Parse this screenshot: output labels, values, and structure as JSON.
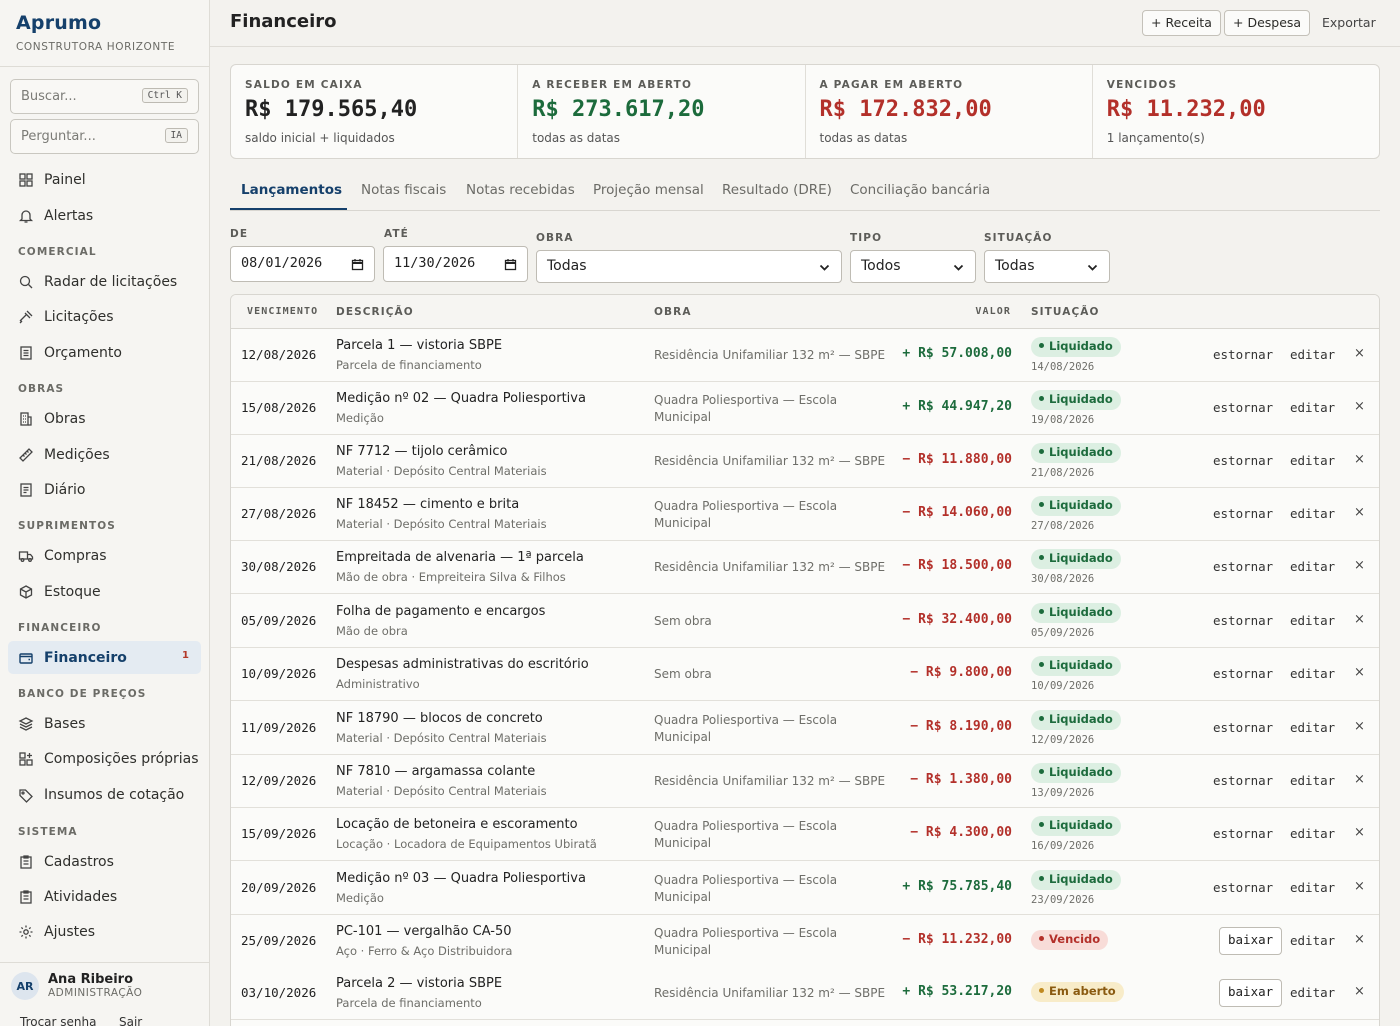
{
  "brand": {
    "name": "Aprumo",
    "subtitle": "CONSTRUTORA HORIZONTE"
  },
  "sidebar": {
    "search": {
      "placeholder": "Buscar...",
      "shortcut": "Ctrl K"
    },
    "ask": {
      "placeholder": "Perguntar...",
      "shortcut": "IA"
    },
    "nav": {
      "painel": "Painel",
      "alertas": "Alertas",
      "sec_comercial": "COMERCIAL",
      "radar": "Radar de licitações",
      "licitacoes": "Licitações",
      "orcamento": "Orçamento",
      "sec_obras": "OBRAS",
      "obras": "Obras",
      "medicoes": "Medições",
      "diario": "Diário",
      "sec_suprimentos": "SUPRIMENTOS",
      "compras": "Compras",
      "estoque": "Estoque",
      "sec_financeiro": "FINANCEIRO",
      "financeiro": "Financeiro",
      "financeiro_badge": "1",
      "sec_banco": "BANCO DE PREÇOS",
      "bases": "Bases",
      "composicoes": "Composições próprias",
      "insumos": "Insumos de cotação",
      "sec_sistema": "SISTEMA",
      "cadastros": "Cadastros",
      "atividades": "Atividades",
      "ajustes": "Ajustes"
    },
    "user": {
      "initials": "AR",
      "name": "Ana Ribeiro",
      "role": "ADMINISTRAÇÃO",
      "change_password": "Trocar senha",
      "logout": "Sair"
    }
  },
  "header": {
    "title": "Financeiro",
    "btn_receita": "+ Receita",
    "btn_despesa": "+ Despesa",
    "export": "Exportar"
  },
  "kpis": [
    {
      "label": "SALDO EM CAIXA",
      "value": "R$ 179.565,40",
      "note": "saldo inicial + liquidados",
      "color": "#222222"
    },
    {
      "label": "A RECEBER EM ABERTO",
      "value": "R$ 273.617,20",
      "note": "todas as datas",
      "color": "#1c6b3c"
    },
    {
      "label": "A PAGAR EM ABERTO",
      "value": "R$ 172.832,00",
      "note": "todas as datas",
      "color": "#b3302a"
    },
    {
      "label": "VENCIDOS",
      "value": "R$ 11.232,00",
      "note": "1 lançamento(s)",
      "color": "#b3302a"
    }
  ],
  "tabs": [
    "Lançamentos",
    "Notas fiscais",
    "Notas recebidas",
    "Projeção mensal",
    "Resultado (DRE)",
    "Conciliação bancária"
  ],
  "filters": {
    "de_label": "DE",
    "de_value": "08/01/2026",
    "ate_label": "ATÉ",
    "ate_value": "11/30/2026",
    "obra_label": "OBRA",
    "obra_value": "Todas",
    "tipo_label": "TIPO",
    "tipo_value": "Todos",
    "situacao_label": "SITUAÇÃO",
    "situacao_value": "Todas"
  },
  "table": {
    "headers": {
      "vencimento": "VENCIMENTO",
      "descricao": "DESCRIÇÃO",
      "obra": "OBRA",
      "valor": "VALOR",
      "situacao": "SITUAÇÃO"
    },
    "actions": {
      "estornar": "estornar",
      "editar": "editar",
      "baixar": "baixar",
      "remove": "×"
    },
    "rows": [
      {
        "date": "12/08/2026",
        "desc": "Parcela 1 — vistoria SBPE",
        "cat": "Parcela de financiamento",
        "obra": "Residência Unifamiliar 132 m² — SBPE",
        "valor": "+ R$ 57.008,00",
        "kind": "pos",
        "status": "Liquidado",
        "status_date": "14/08/2026"
      },
      {
        "date": "15/08/2026",
        "desc": "Medição nº 02 — Quadra Poliesportiva",
        "cat": "Medição",
        "obra": "Quadra Poliesportiva — Escola Municipal",
        "valor": "+ R$ 44.947,20",
        "kind": "pos",
        "status": "Liquidado",
        "status_date": "19/08/2026"
      },
      {
        "date": "21/08/2026",
        "desc": "NF 7712 — tijolo cerâmico",
        "cat": "Material · Depósito Central Materiais",
        "obra": "Residência Unifamiliar 132 m² — SBPE",
        "valor": "− R$ 11.880,00",
        "kind": "neg",
        "status": "Liquidado",
        "status_date": "21/08/2026"
      },
      {
        "date": "27/08/2026",
        "desc": "NF 18452 — cimento e brita",
        "cat": "Material · Depósito Central Materiais",
        "obra": "Quadra Poliesportiva — Escola Municipal",
        "valor": "− R$ 14.060,00",
        "kind": "neg",
        "status": "Liquidado",
        "status_date": "27/08/2026"
      },
      {
        "date": "30/08/2026",
        "desc": "Empreitada de alvenaria — 1ª parcela",
        "cat": "Mão de obra · Empreiteira Silva & Filhos",
        "obra": "Residência Unifamiliar 132 m² — SBPE",
        "valor": "− R$ 18.500,00",
        "kind": "neg",
        "status": "Liquidado",
        "status_date": "30/08/2026"
      },
      {
        "date": "05/09/2026",
        "desc": "Folha de pagamento e encargos",
        "cat": "Mão de obra",
        "obra": "Sem obra",
        "valor": "− R$ 32.400,00",
        "kind": "neg",
        "status": "Liquidado",
        "status_date": "05/09/2026"
      },
      {
        "date": "10/09/2026",
        "desc": "Despesas administrativas do escritório",
        "cat": "Administrativo",
        "obra": "Sem obra",
        "valor": "− R$ 9.800,00",
        "kind": "neg",
        "status": "Liquidado",
        "status_date": "10/09/2026"
      },
      {
        "date": "11/09/2026",
        "desc": "NF 18790 — blocos de concreto",
        "cat": "Material · Depósito Central Materiais",
        "obra": "Quadra Poliesportiva — Escola Municipal",
        "valor": "− R$ 8.190,00",
        "kind": "neg",
        "status": "Liquidado",
        "status_date": "12/09/2026"
      },
      {
        "date": "12/09/2026",
        "desc": "NF 7810 — argamassa colante",
        "cat": "Material · Depósito Central Materiais",
        "obra": "Residência Unifamiliar 132 m² — SBPE",
        "valor": "− R$ 1.380,00",
        "kind": "neg",
        "status": "Liquidado",
        "status_date": "13/09/2026"
      },
      {
        "date": "15/09/2026",
        "desc": "Locação de betoneira e escoramento",
        "cat": "Locação · Locadora de Equipamentos Ubiratã",
        "obra": "Quadra Poliesportiva — Escola Municipal",
        "valor": "− R$ 4.300,00",
        "kind": "neg",
        "status": "Liquidado",
        "status_date": "16/09/2026"
      },
      {
        "date": "20/09/2026",
        "desc": "Medição nº 03 — Quadra Poliesportiva",
        "cat": "Medição",
        "obra": "Quadra Poliesportiva — Escola Municipal",
        "valor": "+ R$ 75.785,40",
        "kind": "pos",
        "status": "Liquidado",
        "status_date": "23/09/2026"
      },
      {
        "date": "25/09/2026",
        "desc": "PC-101 — vergalhão CA-50",
        "cat": "Aço · Ferro & Aço Distribuidora",
        "obra": "Quadra Poliesportiva — Escola Municipal",
        "valor": "− R$ 11.232,00",
        "kind": "neg",
        "status": "Vencido",
        "status_date": ""
      },
      {
        "date": "03/10/2026",
        "desc": "Parcela 2 — vistoria SBPE",
        "cat": "Parcela de financiamento",
        "obra": "Residência Unifamiliar 132 m² — SBPE",
        "valor": "+ R$ 53.217,20",
        "kind": "pos",
        "status": "Em aberto",
        "status_date": ""
      }
    ]
  }
}
